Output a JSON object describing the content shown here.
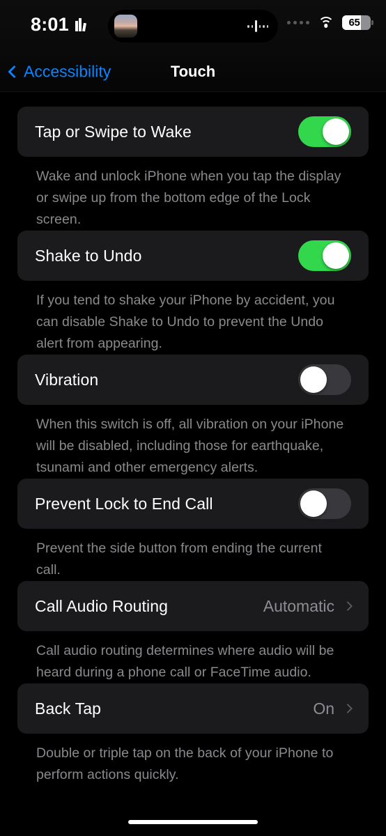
{
  "status_bar": {
    "time": "8:01",
    "activity_icon": "books-icon",
    "dynamic_island": {
      "thumbnail_icon": "media-artwork-thumbnail",
      "waveform_icon": "audio-waveform-icon"
    },
    "cellular_icon": "cellular-dots-icon",
    "wifi_icon": "wifi-icon",
    "battery": {
      "percent": "65",
      "level": 65
    }
  },
  "nav": {
    "back_label": "Accessibility",
    "back_icon": "chevron-left-icon",
    "title": "Touch"
  },
  "colors": {
    "background": "#000000",
    "card": "#1b1b1d",
    "accent_blue": "#0a84ff",
    "toggle_on": "#32d74b",
    "toggle_off": "#39393d",
    "label": "#ffffff",
    "secondary_label": "#8a8a8e"
  },
  "sections": [
    {
      "name": "tap-or-swipe-to-wake",
      "label": "Tap or Swipe to Wake",
      "control": "toggle",
      "state": "on",
      "footnote": "Wake and unlock iPhone when you tap the display or swipe up from the bottom edge of the Lock screen."
    },
    {
      "name": "shake-to-undo",
      "label": "Shake to Undo",
      "control": "toggle",
      "state": "on",
      "footnote": "If you tend to shake your iPhone by accident, you can disable Shake to Undo to prevent the Undo alert from appearing."
    },
    {
      "name": "vibration",
      "label": "Vibration",
      "control": "toggle",
      "state": "off",
      "footnote": "When this switch is off, all vibration on your iPhone will be disabled, including those for earthquake, tsunami and other emergency alerts."
    },
    {
      "name": "prevent-lock-to-end-call",
      "label": "Prevent Lock to End Call",
      "control": "toggle",
      "state": "off",
      "footnote": "Prevent the side button from ending the current call."
    },
    {
      "name": "call-audio-routing",
      "label": "Call Audio Routing",
      "control": "disclosure",
      "value": "Automatic",
      "footnote": "Call audio routing determines where audio will be heard during a phone call or FaceTime audio."
    },
    {
      "name": "back-tap",
      "label": "Back Tap",
      "control": "disclosure",
      "value": "On",
      "footnote": "Double or triple tap on the back of your iPhone to perform actions quickly."
    }
  ]
}
